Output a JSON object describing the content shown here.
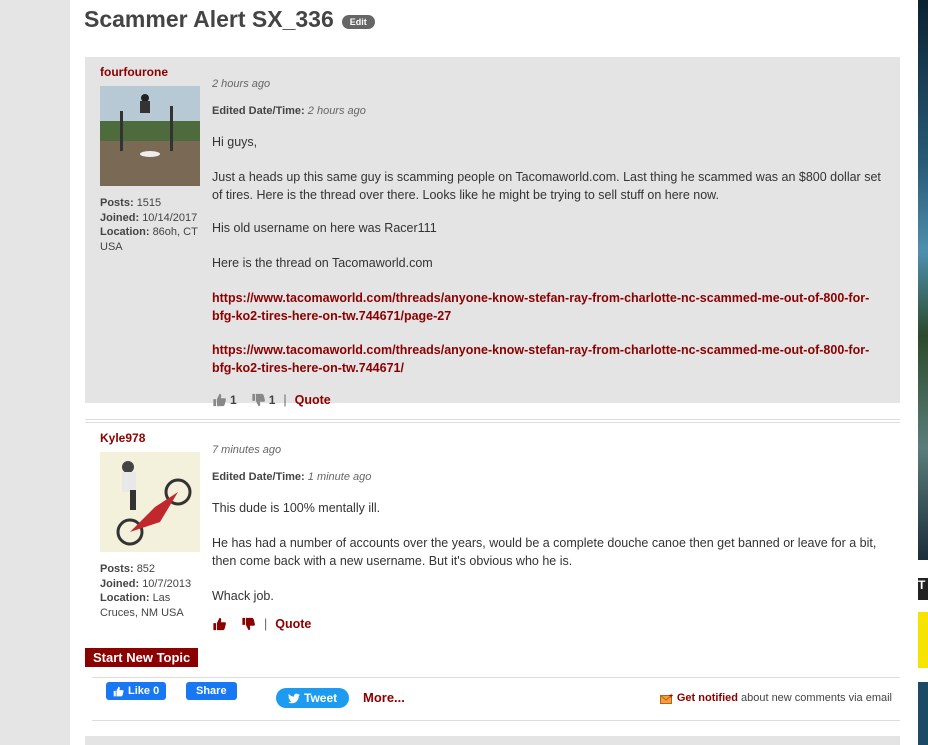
{
  "topic": {
    "title": "Scammer Alert SX_336",
    "edit_label": "Edit"
  },
  "posts": [
    {
      "username": "fourfourone",
      "stats": {
        "posts_label": "Posts:",
        "posts": "1515",
        "joined_label": "Joined:",
        "joined": "10/14/2017",
        "location_label": "Location:",
        "location": "86oh, CT USA"
      },
      "time": "2 hours ago",
      "edited_label": "Edited Date/Time:",
      "edited_time": "2 hours ago",
      "paragraphs": [
        "Hi guys,",
        "Just a heads up this same guy is scamming people on Tacomaworld.com. Last thing he scammed was an $800 dollar set of tires. Here is the thread over there. Looks like he might be trying to sell stuff on here now.",
        "His old username on here was Racer111",
        "Here is the thread on Tacomaworld.com"
      ],
      "links": [
        "https://www.tacomaworld.com/threads/anyone-know-stefan-ray-from-charlotte-nc-scammed-me-out-of-800-for-bfg-ko2-tires-here-on-tw.744671/page-27",
        "https://www.tacomaworld.com/threads/anyone-know-stefan-ray-from-charlotte-nc-scammed-me-out-of-800-for-bfg-ko2-tires-here-on-tw.744671/"
      ],
      "likes": "1",
      "dislikes": "1",
      "quote_label": "Quote"
    },
    {
      "username": "Kyle978",
      "stats": {
        "posts_label": "Posts:",
        "posts": "852",
        "joined_label": "Joined:",
        "joined": "10/7/2013",
        "location_label": "Location:",
        "location": "Las Cruces, NM USA"
      },
      "time": "7 minutes ago",
      "edited_label": "Edited Date/Time:",
      "edited_time": "1 minute ago",
      "paragraphs": [
        "This dude is 100% mentally ill.",
        "He has had a number of accounts over the years, would be a complete douche canoe then get banned or leave for a bit, then come back with a new username. But it's obvious who he is.",
        "Whack job."
      ],
      "quote_label": "Quote"
    }
  ],
  "start_topic_label": "Start New Topic",
  "share": {
    "fb_like": "Like 0",
    "fb_share": "Share",
    "tweet": "Tweet",
    "more": "More...",
    "notify_get": "Get notified",
    "notify_rest": "about new comments via email"
  },
  "ad": {
    "letter": "T"
  },
  "colors": {
    "accent": "#8b0000",
    "facebook": "#1877f2",
    "twitter": "#1d9bf0"
  }
}
